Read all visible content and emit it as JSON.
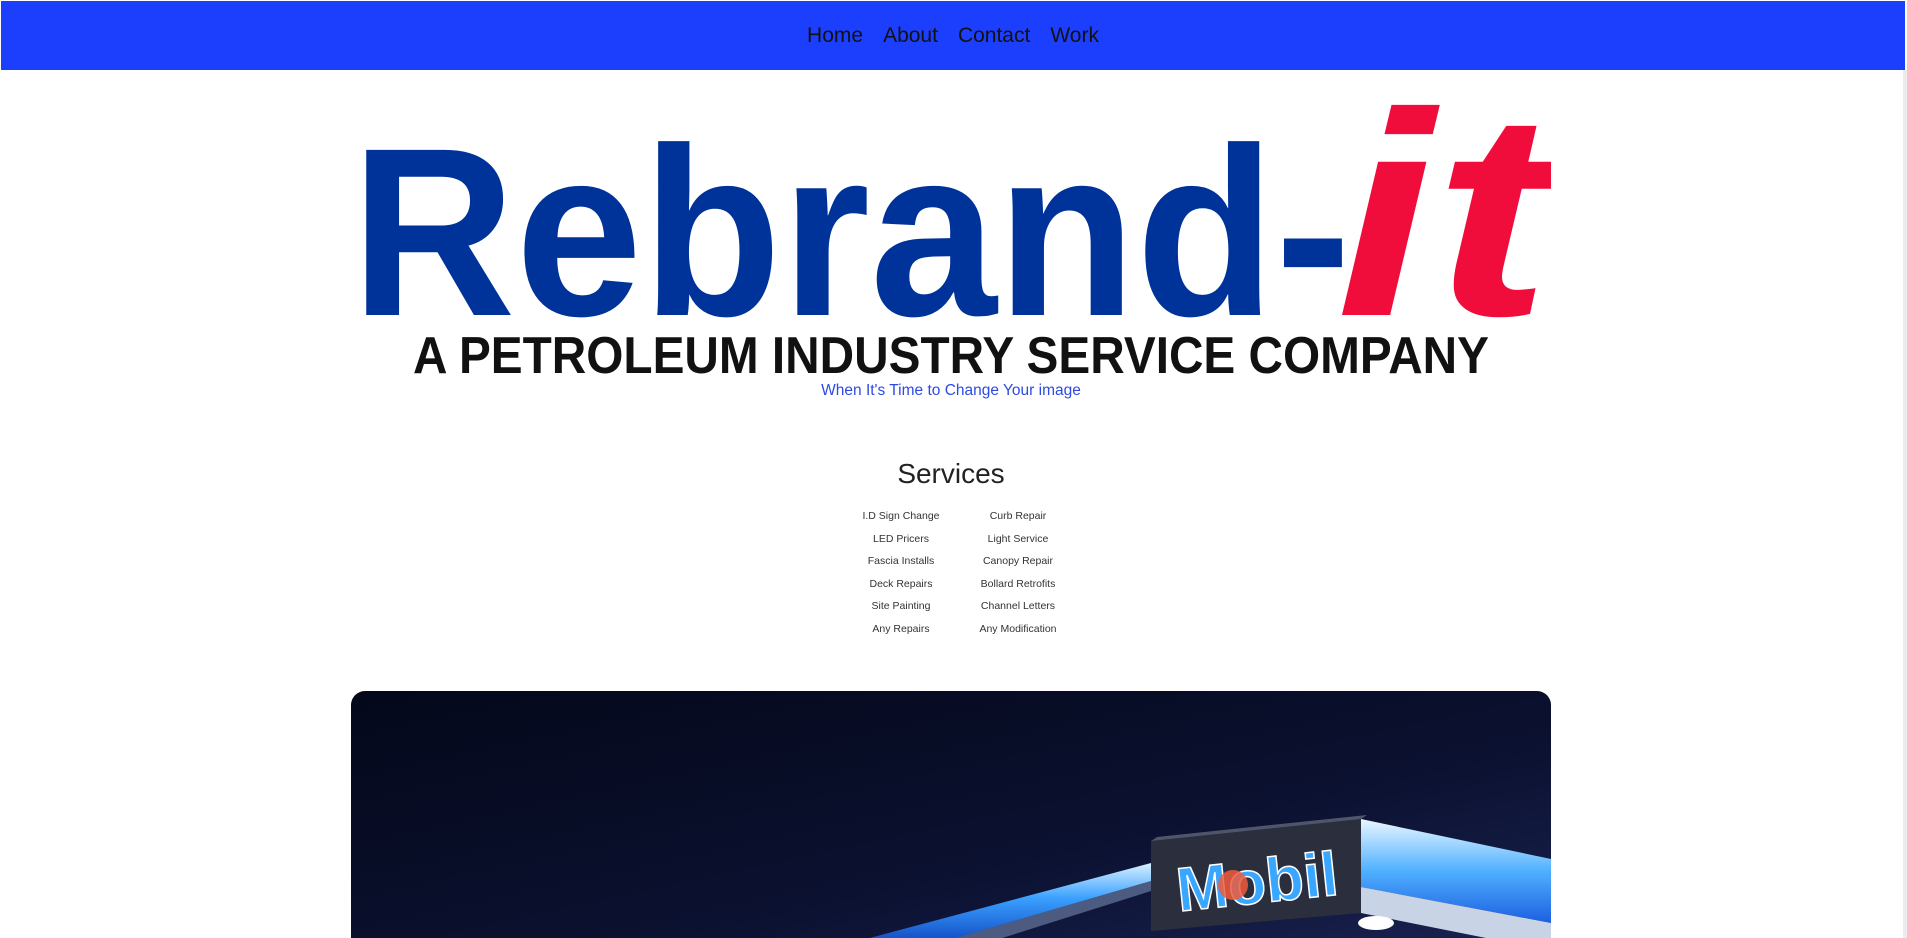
{
  "nav": {
    "items": [
      {
        "label": "Home"
      },
      {
        "label": "About"
      },
      {
        "label": "Contact"
      },
      {
        "label": "Work"
      }
    ]
  },
  "logo": {
    "brand_main": "Rebrand-",
    "brand_accent": "it",
    "subtitle": "A PETROLEUM INDUSTRY SERVICE COMPANY"
  },
  "tagline": "When It's Time to Change Your image",
  "services": {
    "title": "Services",
    "items": [
      "I.D Sign Change",
      "Curb Repair",
      "LED Pricers",
      "Light Service",
      "Fascia Installs",
      "Canopy Repair",
      "Deck Repairs",
      "Bollard Retrofits",
      "Site Painting",
      "Channel Letters",
      "Any Repairs",
      "Any Modification"
    ]
  },
  "hero": {
    "sign_text": "Mobil"
  },
  "colors": {
    "nav_bg": "#1c3ffd",
    "logo_blue": "#003399",
    "logo_red": "#f00d3c",
    "tagline": "#2d4ae3"
  }
}
